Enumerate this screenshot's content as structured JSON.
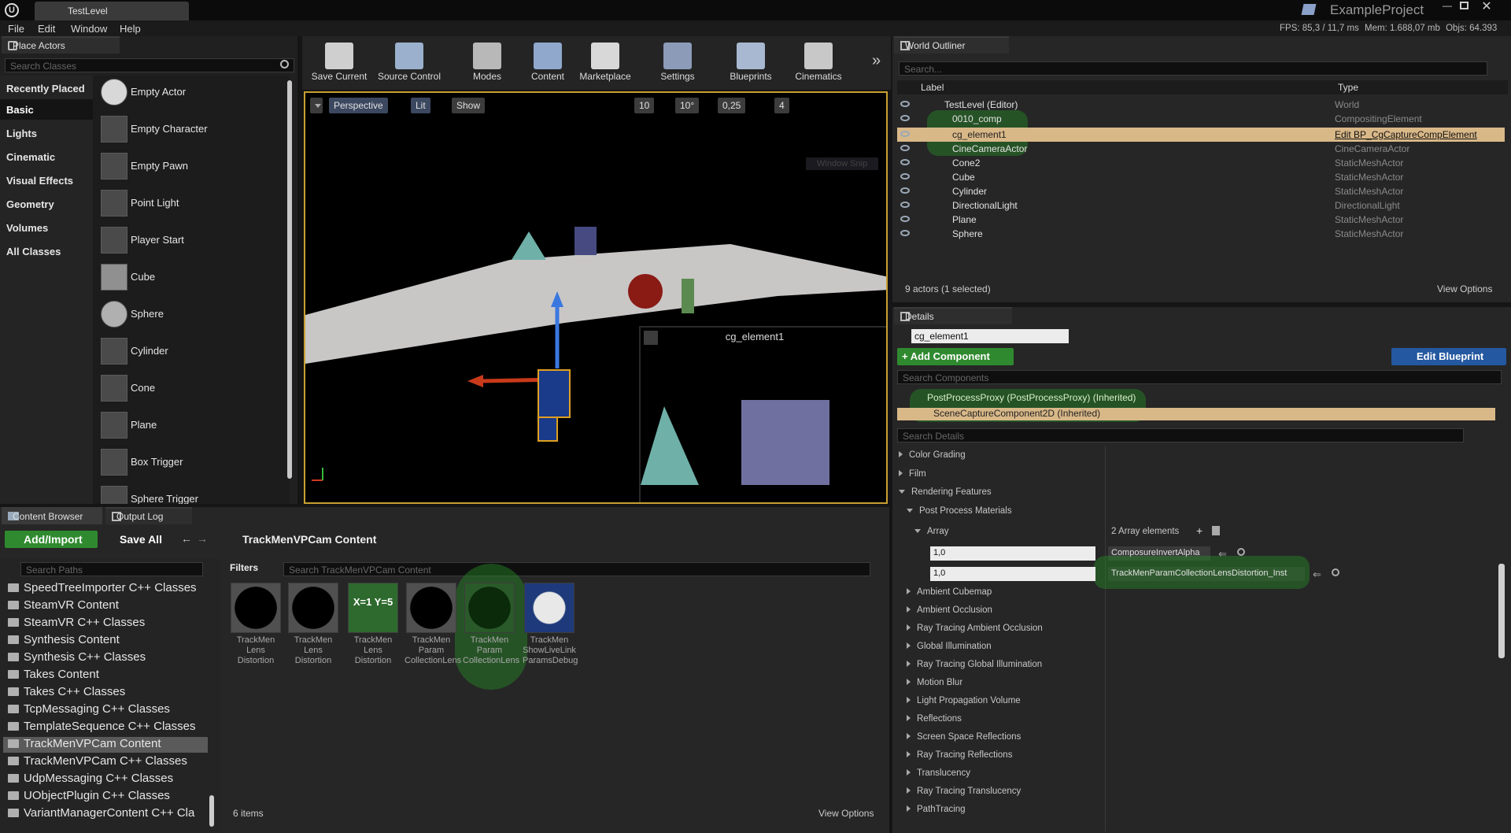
{
  "title_bar": {
    "tab": "TestLevel",
    "project": "ExampleProject"
  },
  "menu": [
    "File",
    "Edit",
    "Window",
    "Help"
  ],
  "stats": {
    "fps": "FPS: 85,3",
    "ms": "/ 11,7 ms",
    "mem_label": "Mem:",
    "mem": "1.688,07 mb",
    "objs_label": "Objs:",
    "objs": "64.393"
  },
  "place_actors": {
    "tab": "Place Actors",
    "search_placeholder": "Search Classes",
    "categories": [
      "Recently Placed",
      "Basic",
      "Lights",
      "Cinematic",
      "Visual Effects",
      "Geometry",
      "Volumes",
      "All Classes"
    ],
    "selected_category": "Basic",
    "actors": [
      "Empty Actor",
      "Empty Character",
      "Empty Pawn",
      "Point Light",
      "Player Start",
      "Cube",
      "Sphere",
      "Cylinder",
      "Cone",
      "Plane",
      "Box Trigger",
      "Sphere Trigger"
    ]
  },
  "toolbar": {
    "buttons": [
      "Save Current",
      "Source Control",
      "Modes",
      "Content",
      "Marketplace",
      "Settings",
      "Blueprints",
      "Cinematics"
    ]
  },
  "viewport": {
    "perspective": "Perspective",
    "lit": "Lit",
    "show": "Show",
    "grid": "10",
    "angle": "10°",
    "scale": "0,25",
    "cam_speed": "4",
    "pip_title": "cg_element1",
    "ghost": "Window Snip"
  },
  "outliner": {
    "tab": "World Outliner",
    "search_placeholder": "Search...",
    "col_label": "Label",
    "col_type": "Type",
    "rows": [
      {
        "label": "TestLevel (Editor)",
        "type": "World"
      },
      {
        "label": "0010_comp",
        "type": "CompositingElement"
      },
      {
        "label": "cg_element1",
        "type": "Edit BP_CgCaptureCompElement"
      },
      {
        "label": "CineCameraActor",
        "type": "CineCameraActor"
      },
      {
        "label": "Cone2",
        "type": "StaticMeshActor"
      },
      {
        "label": "Cube",
        "type": "StaticMeshActor"
      },
      {
        "label": "Cylinder",
        "type": "StaticMeshActor"
      },
      {
        "label": "DirectionalLight",
        "type": "DirectionalLight"
      },
      {
        "label": "Plane",
        "type": "StaticMeshActor"
      },
      {
        "label": "Sphere",
        "type": "StaticMeshActor"
      }
    ],
    "footer": "9 actors (1 selected)",
    "view_options": "View Options"
  },
  "details": {
    "tab": "Details",
    "name": "cg_element1",
    "add_component": "+ Add Component",
    "edit_blueprint": "Edit Blueprint",
    "search_components": "Search Components",
    "components": [
      "PostProcessProxy (PostProcessProxy) (Inherited)",
      "SceneCaptureComponent2D (Inherited)"
    ],
    "search_details": "Search Details",
    "sections_top": [
      "Color Grading",
      "Film",
      "Rendering Features"
    ],
    "post_process_materials": "Post Process Materials",
    "array_label": "Array",
    "array_count": "2 Array elements",
    "elements": [
      {
        "weight": "1,0",
        "value": "ComposureInvertAlpha"
      },
      {
        "weight": "1,0",
        "value": "TrackMenParamCollectionLensDistortion_Inst"
      }
    ],
    "sections": [
      "Ambient Cubemap",
      "Ambient Occlusion",
      "Ray Tracing Ambient Occlusion",
      "Global Illumination",
      "Ray Tracing Global Illumination",
      "Motion Blur",
      "Light Propagation Volume",
      "Reflections",
      "Screen Space Reflections",
      "Ray Tracing Reflections",
      "Translucency",
      "Ray Tracing Translucency",
      "PathTracing"
    ]
  },
  "content_browser": {
    "tab": "Content Browser",
    "tab2": "Output Log",
    "add_import": "Add/Import",
    "save_all": "Save All",
    "path": "TrackMenVPCam Content",
    "search_paths": "Search Paths",
    "filters": "Filters",
    "search_content": "Search TrackMenVPCam Content",
    "folders": [
      "SpeedTreeImporter C++ Classes",
      "SteamVR Content",
      "SteamVR C++ Classes",
      "Synthesis Content",
      "Synthesis C++ Classes",
      "Takes Content",
      "Takes C++ Classes",
      "TcpMessaging C++ Classes",
      "TemplateSequence C++ Classes",
      "TrackMenVPCam Content",
      "TrackMenVPCam C++ Classes",
      "UdpMessaging C++ Classes",
      "UObjectPlugin C++ Classes",
      "VariantManagerContent C++ Cla"
    ],
    "selected_folder": "TrackMenVPCam Content",
    "assets": [
      {
        "l1": "TrackMen",
        "l2": "Lens",
        "l3": "Distortion"
      },
      {
        "l1": "TrackMen",
        "l2": "Lens",
        "l3": "Distortion"
      },
      {
        "l1": "TrackMen",
        "l2": "Lens",
        "l3": "Distortion"
      },
      {
        "l1": "TrackMen",
        "l2": "Param",
        "l3": "CollectionLens"
      },
      {
        "l1": "TrackMen",
        "l2": "Param",
        "l3": "CollectionLens"
      },
      {
        "l1": "TrackMen",
        "l2": "ShowLiveLink",
        "l3": "ParamsDebug"
      }
    ],
    "xy_icon": "X=1 Y=5",
    "count": "6 items",
    "view_options": "View Options"
  }
}
